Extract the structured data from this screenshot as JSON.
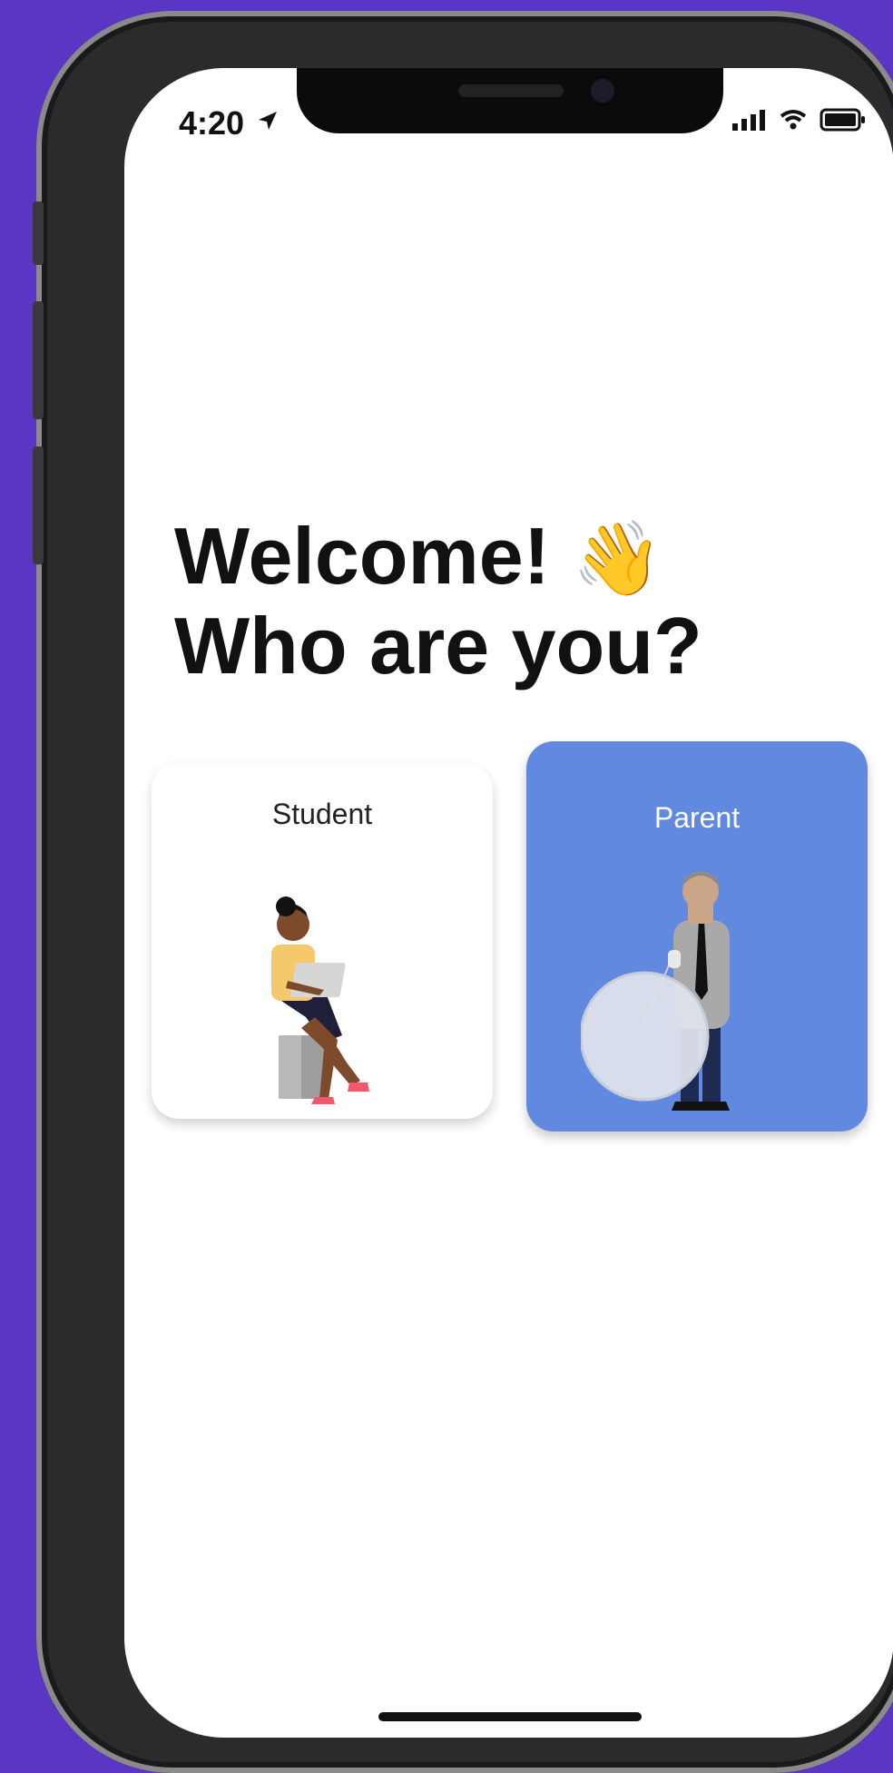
{
  "status_bar": {
    "time": "4:20",
    "icons": [
      "location-arrow-icon",
      "signal-icon",
      "wifi-icon",
      "battery-icon"
    ]
  },
  "headline": {
    "line1": "Welcome!",
    "emoji": "👋",
    "line2": "Who are you?"
  },
  "roles": [
    {
      "label": "Student",
      "selected": false,
      "card_color": "#ffffff",
      "illustration": "student-with-laptop"
    },
    {
      "label": "Parent",
      "selected": true,
      "card_color": "#6189e0",
      "illustration": "parent-with-balloon"
    }
  ],
  "colors": {
    "background": "#5b35c4",
    "accent": "#6189e0",
    "text": "#111111"
  }
}
